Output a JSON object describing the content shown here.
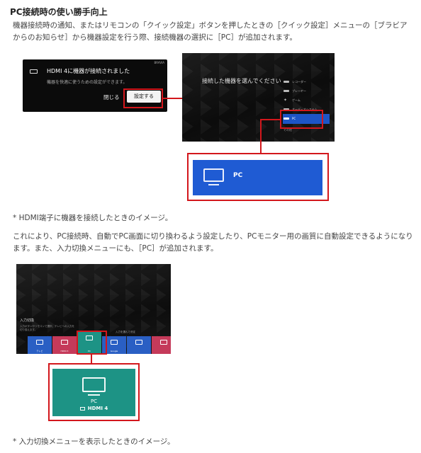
{
  "heading": "PC接続時の使い勝手向上",
  "paragraph1": "機器接続時の通知、またはリモコンの「クイック設定」ボタンを押したときの［クイック設定］メニューの［ブラビアからのお知らせ］から機器設定を行う際、接続機器の選択に［PC］が追加されます。",
  "figure1": {
    "notification": {
      "brand_tag": "BRAVIA",
      "title": "HDMI 4に機器が接続されました",
      "message": "機器を快適に使うための設定ができます。",
      "close_label": "閉じる",
      "settings_label": "設定する"
    },
    "menu": {
      "prompt": "接続した機器を選んでください",
      "items": [
        {
          "label": "レコーダー"
        },
        {
          "label": "プレーヤー"
        },
        {
          "label": "ゲーム"
        },
        {
          "label": "オーディオシステム"
        },
        {
          "label": "PC"
        }
      ],
      "footer": "その他"
    },
    "pc_label": "PC"
  },
  "caption1": "* HDMI端子に機器を接続したときのイメージ。",
  "paragraph2": "これにより、PC接続時、自動でPC画面に切り換わるよう設定したり、PCモニター用の画質に自動設定できるようになります。また、入力切換メニューにも、［PC］が追加されます。",
  "figure2": {
    "title": "入力切換",
    "hint": "入力ボタンやリモコンで選択。テレビへの入力を切り換えます。",
    "hint_right": "入力を選んで決定",
    "tiles": [
      {
        "label": "テレビ",
        "color": "#2a5fc4"
      },
      {
        "label": "HDMI 3",
        "color": "#c53a5a"
      },
      {
        "label": "PC",
        "color": "#1d9385"
      },
      {
        "label": "Google",
        "color": "#2a5fc4"
      },
      {
        "label": "",
        "color": "#2a5fc4"
      },
      {
        "label": "",
        "color": "#c53a5a"
      }
    ],
    "pc_label": "PC",
    "pc_input": "HDMI 4"
  },
  "caption2": "* 入力切換メニューを表示したときのイメージ。",
  "colors": {
    "highlight_red": "#d3171c",
    "selection_blue": "#1f5bd3",
    "pc_teal": "#1d9385"
  }
}
